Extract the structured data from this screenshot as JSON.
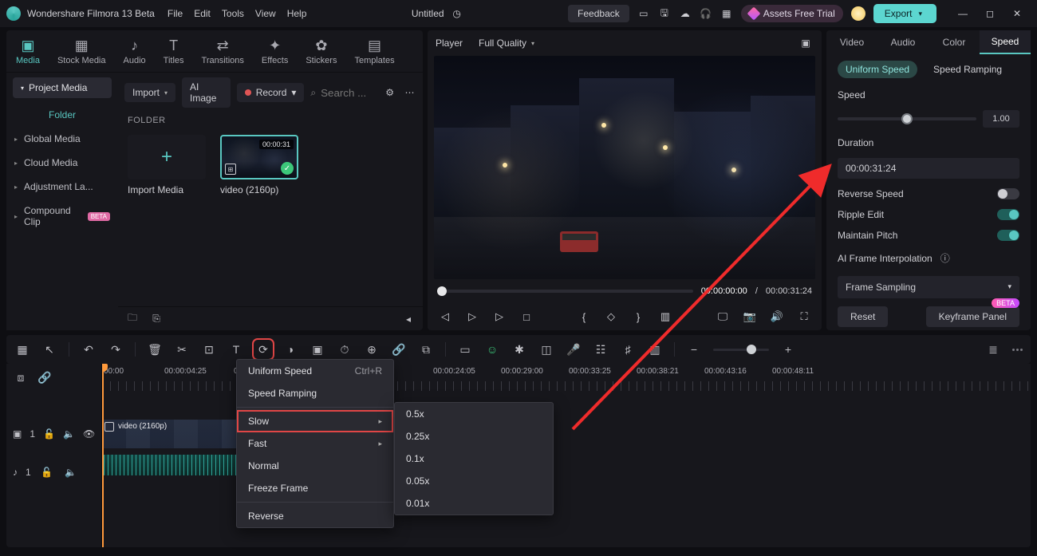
{
  "app": {
    "name": "Wondershare Filmora 13 Beta",
    "document": "Untitled"
  },
  "menubar": [
    "File",
    "Edit",
    "Tools",
    "View",
    "Help"
  ],
  "titlebar": {
    "feedback": "Feedback",
    "trial": "Assets Free Trial",
    "export": "Export"
  },
  "media_tabs": [
    {
      "label": "Media",
      "icon": "▣",
      "active": true
    },
    {
      "label": "Stock Media",
      "icon": "▣",
      "active": false
    },
    {
      "label": "Audio",
      "icon": "♪",
      "active": false
    },
    {
      "label": "Titles",
      "icon": "T",
      "active": false
    },
    {
      "label": "Transitions",
      "icon": "⇄",
      "active": false
    },
    {
      "label": "Effects",
      "icon": "✦",
      "active": false
    },
    {
      "label": "Stickers",
      "icon": "✿",
      "active": false
    },
    {
      "label": "Templates",
      "icon": "▦",
      "active": false
    }
  ],
  "media_side": {
    "project": "Project Media",
    "folder_head": "Folder",
    "tree": [
      {
        "label": "Global Media"
      },
      {
        "label": "Cloud Media"
      },
      {
        "label": "Adjustment La..."
      },
      {
        "label": "Compound Clip",
        "badge": "BETA"
      }
    ]
  },
  "media_tools": {
    "import": "Import",
    "ai_image": "AI Image",
    "record": "Record",
    "search_placeholder": "Search ..."
  },
  "folder_label": "FOLDER",
  "media_items": [
    {
      "type": "import",
      "label": "Import Media"
    },
    {
      "type": "video",
      "label": "video (2160p)",
      "duration": "00:00:31"
    }
  ],
  "player": {
    "tab": "Player",
    "quality": "Full Quality",
    "current": "00:00:00:00",
    "sep": "/",
    "total": "00:00:31:24"
  },
  "inspector": {
    "tabs": [
      "Video",
      "Audio",
      "Color",
      "Speed"
    ],
    "active_tab": "Speed",
    "mode_active": "Uniform Speed",
    "mode_other": "Speed Ramping",
    "speed_label": "Speed",
    "speed_value": "1.00",
    "duration_label": "Duration",
    "duration_value": "00:00:31:24",
    "toggles": [
      {
        "label": "Reverse Speed",
        "on": false
      },
      {
        "label": "Ripple Edit",
        "on": true
      },
      {
        "label": "Maintain Pitch",
        "on": true
      }
    ],
    "interp_label": "AI Frame Interpolation",
    "interp_value": "Frame Sampling",
    "reset": "Reset",
    "keyframe": "Keyframe Panel",
    "keyframe_badge": "BETA"
  },
  "timeline": {
    "ticks": [
      "00:00",
      "00:00:04:25",
      "00:00:0...",
      "00:00:24:05",
      "00:00:29:00",
      "00:00:33:25",
      "00:00:38:21",
      "00:00:43:16",
      "00:00:48:11"
    ],
    "tracks": {
      "video": {
        "id": "1",
        "clip_label": "video (2160p)"
      },
      "audio": {
        "id": "1"
      }
    }
  },
  "speed_menu": {
    "items": [
      {
        "label": "Uniform Speed",
        "shortcut": "Ctrl+R"
      },
      {
        "label": "Speed Ramping"
      },
      {
        "sep": true
      },
      {
        "label": "Slow",
        "sub": true,
        "highlight": true
      },
      {
        "label": "Fast",
        "sub": true
      },
      {
        "label": "Normal"
      },
      {
        "label": "Freeze Frame"
      },
      {
        "sep": true
      },
      {
        "label": "Reverse"
      }
    ],
    "slow_sub": [
      "0.5x",
      "0.25x",
      "0.1x",
      "0.05x",
      "0.01x"
    ]
  }
}
